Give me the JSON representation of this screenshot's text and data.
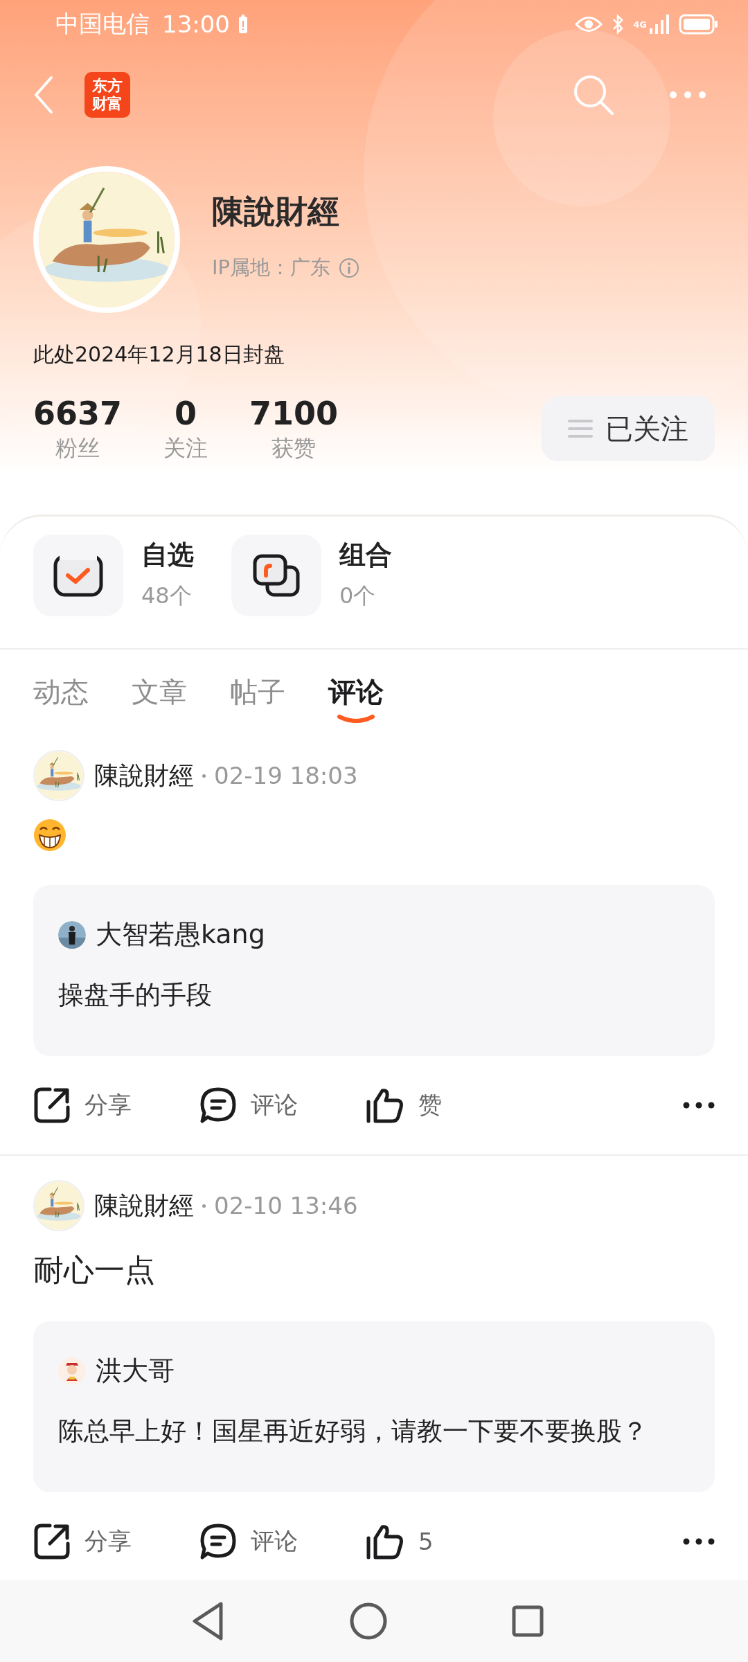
{
  "status_bar": {
    "carrier": "中国电信",
    "time": "13:00",
    "network": "4G"
  },
  "header": {
    "logo_lines": [
      "东方",
      "财富"
    ]
  },
  "profile": {
    "name": "陳說財經",
    "ip_location": "IP属地：广东",
    "bio": "此处2024年12月18日封盘",
    "stats": [
      {
        "value": "6637",
        "label": "粉丝"
      },
      {
        "value": "0",
        "label": "关注"
      },
      {
        "value": "7100",
        "label": "获赞"
      }
    ],
    "follow_button": {
      "label": "已关注",
      "following": true
    }
  },
  "shortcuts": [
    {
      "kind": "watchlist",
      "title": "自选",
      "count": "48个"
    },
    {
      "kind": "portfolio",
      "title": "组合",
      "count": "0个"
    }
  ],
  "tabs": [
    {
      "label": "动态",
      "selected": false
    },
    {
      "label": "文章",
      "selected": false
    },
    {
      "label": "帖子",
      "selected": false
    },
    {
      "label": "评论",
      "selected": true
    }
  ],
  "posts": [
    {
      "author": "陳說財經",
      "time": "02-19 18:03",
      "body": {
        "kind": "emoji"
      },
      "quote": {
        "author": "大智若愚kang",
        "text": "操盘手的手段"
      },
      "actions": [
        {
          "kind": "share",
          "label": "分享"
        },
        {
          "kind": "comment",
          "label": "评论"
        },
        {
          "kind": "like",
          "label": "赞"
        }
      ]
    },
    {
      "author": "陳說財經",
      "time": "02-10 13:46",
      "body": {
        "kind": "text",
        "text": "耐心一点"
      },
      "quote": {
        "author": "洪大哥",
        "text": "陈总早上好！国星再近好弱，请教一下要不要换股？"
      },
      "actions": [
        {
          "kind": "share",
          "label": "分享"
        },
        {
          "kind": "comment",
          "label": "评论"
        },
        {
          "kind": "like",
          "label": "5"
        }
      ]
    }
  ]
}
